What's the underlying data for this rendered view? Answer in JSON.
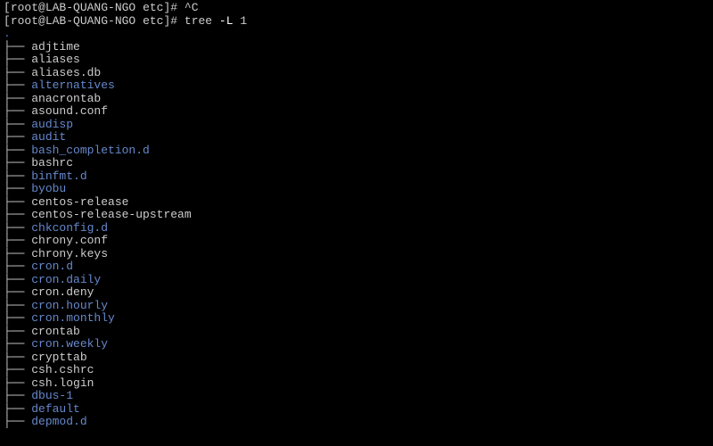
{
  "prompts": [
    {
      "userhost": "root@LAB-QUANG-NGO",
      "path": "etc",
      "symbol": "#",
      "cmd": "^C"
    },
    {
      "userhost": "root@LAB-QUANG-NGO",
      "path": "etc",
      "symbol": "#",
      "cmd_pre": "tree ",
      "flag": "-L",
      "cmd_post": " 1"
    }
  ],
  "tree_root": ".",
  "tree_items": [
    {
      "name": "adjtime",
      "type": "file"
    },
    {
      "name": "aliases",
      "type": "file"
    },
    {
      "name": "aliases.db",
      "type": "file"
    },
    {
      "name": "alternatives",
      "type": "dir"
    },
    {
      "name": "anacrontab",
      "type": "file"
    },
    {
      "name": "asound.conf",
      "type": "file"
    },
    {
      "name": "audisp",
      "type": "dir"
    },
    {
      "name": "audit",
      "type": "dir"
    },
    {
      "name": "bash_completion.d",
      "type": "dir"
    },
    {
      "name": "bashrc",
      "type": "file"
    },
    {
      "name": "binfmt.d",
      "type": "dir"
    },
    {
      "name": "byobu",
      "type": "dir"
    },
    {
      "name": "centos-release",
      "type": "file"
    },
    {
      "name": "centos-release-upstream",
      "type": "file"
    },
    {
      "name": "chkconfig.d",
      "type": "dir"
    },
    {
      "name": "chrony.conf",
      "type": "file"
    },
    {
      "name": "chrony.keys",
      "type": "file"
    },
    {
      "name": "cron.d",
      "type": "dir"
    },
    {
      "name": "cron.daily",
      "type": "dir"
    },
    {
      "name": "cron.deny",
      "type": "file"
    },
    {
      "name": "cron.hourly",
      "type": "dir"
    },
    {
      "name": "cron.monthly",
      "type": "dir"
    },
    {
      "name": "crontab",
      "type": "file"
    },
    {
      "name": "cron.weekly",
      "type": "dir"
    },
    {
      "name": "crypttab",
      "type": "file"
    },
    {
      "name": "csh.cshrc",
      "type": "file"
    },
    {
      "name": "csh.login",
      "type": "file"
    },
    {
      "name": "dbus-1",
      "type": "dir"
    },
    {
      "name": "default",
      "type": "dir"
    },
    {
      "name": "depmod.d",
      "type": "dir"
    }
  ],
  "tree_prefix": "├── "
}
